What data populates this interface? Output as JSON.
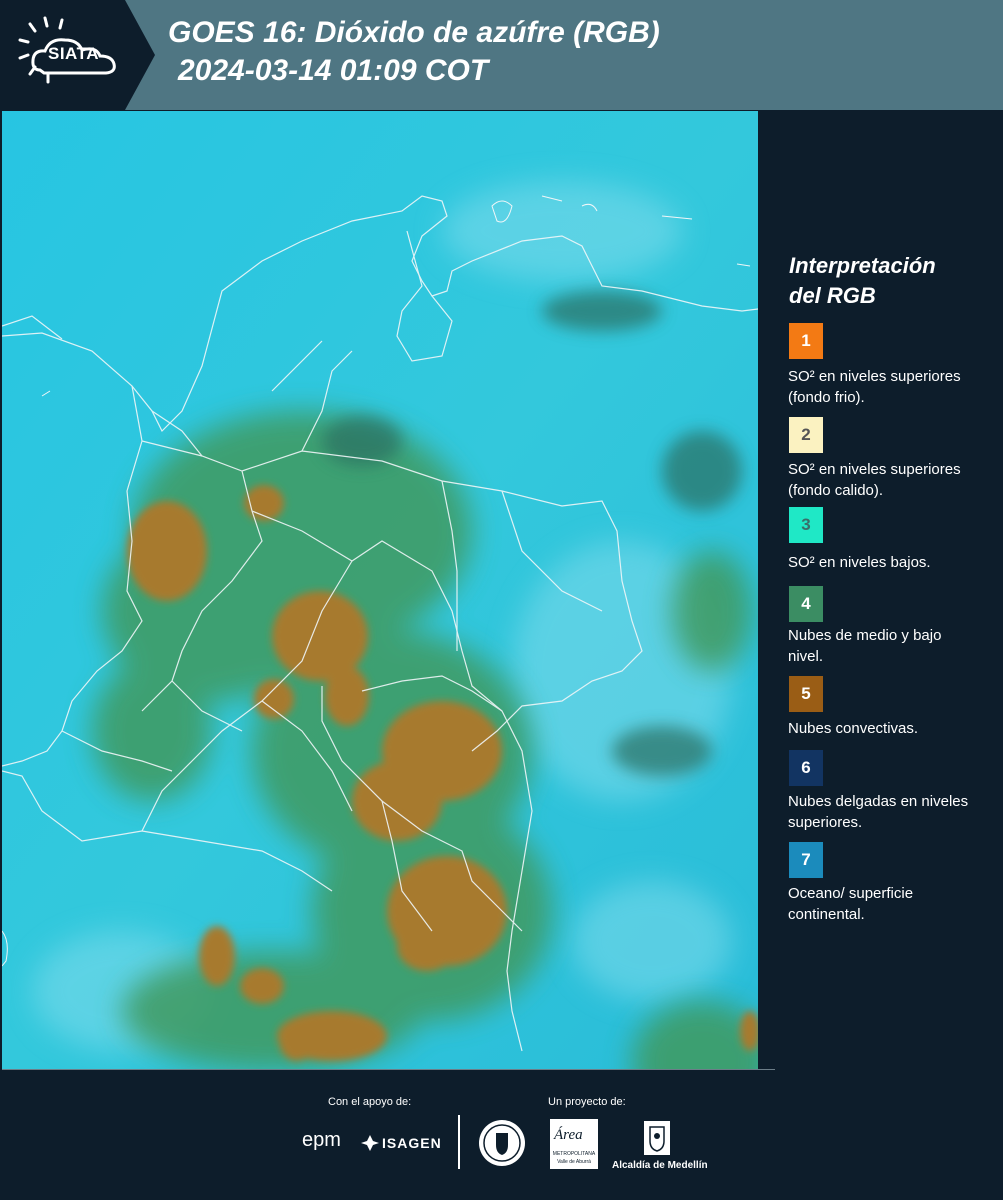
{
  "header": {
    "logo_text": "SIATA",
    "title_line1": "GOES 16: Dióxido de azúfre (RGB)",
    "title_line2": "2024-03-14 01:09 COT"
  },
  "legend": {
    "title_line1": "Interpretación",
    "title_line2": "del RGB",
    "items": [
      {
        "number": "1",
        "color": "#f37a14",
        "label": "SO² en niveles superiores (fondo frio)."
      },
      {
        "number": "2",
        "color": "#fbf2c1",
        "label": "SO² en niveles superiores (fondo calido)."
      },
      {
        "number": "3",
        "color": "#1fe8c6",
        "label": "SO² en niveles bajos."
      },
      {
        "number": "4",
        "color": "#3b8d63",
        "label": "Nubes de medio y bajo nivel."
      },
      {
        "number": "5",
        "color": "#9a5d15",
        "label": "Nubes convectivas."
      },
      {
        "number": "6",
        "color": "#123462",
        "label": "Nubes delgadas en niveles superiores."
      },
      {
        "number": "7",
        "color": "#1b8bbc",
        "label": "Oceano/ superficie continental."
      }
    ]
  },
  "footer": {
    "support_caption": "Con el apoyo de:",
    "project_caption": "Un proyecto de:",
    "sponsor_epm": "epm",
    "sponsor_isagen": "ISAGEN",
    "partner_area": "Área",
    "partner_area_sub": "METROPOLITANA",
    "partner_area_sub2": "Valle de Aburrá",
    "partner_alcaldia": "Alcaldía de Medellín"
  },
  "colors": {
    "header_bg": "#4f7683",
    "panel_bg": "#0d1d2b",
    "map_sky": "#26c3e0",
    "cloud_green": "#3c9a5c",
    "convective_brown": "#a8792e"
  }
}
